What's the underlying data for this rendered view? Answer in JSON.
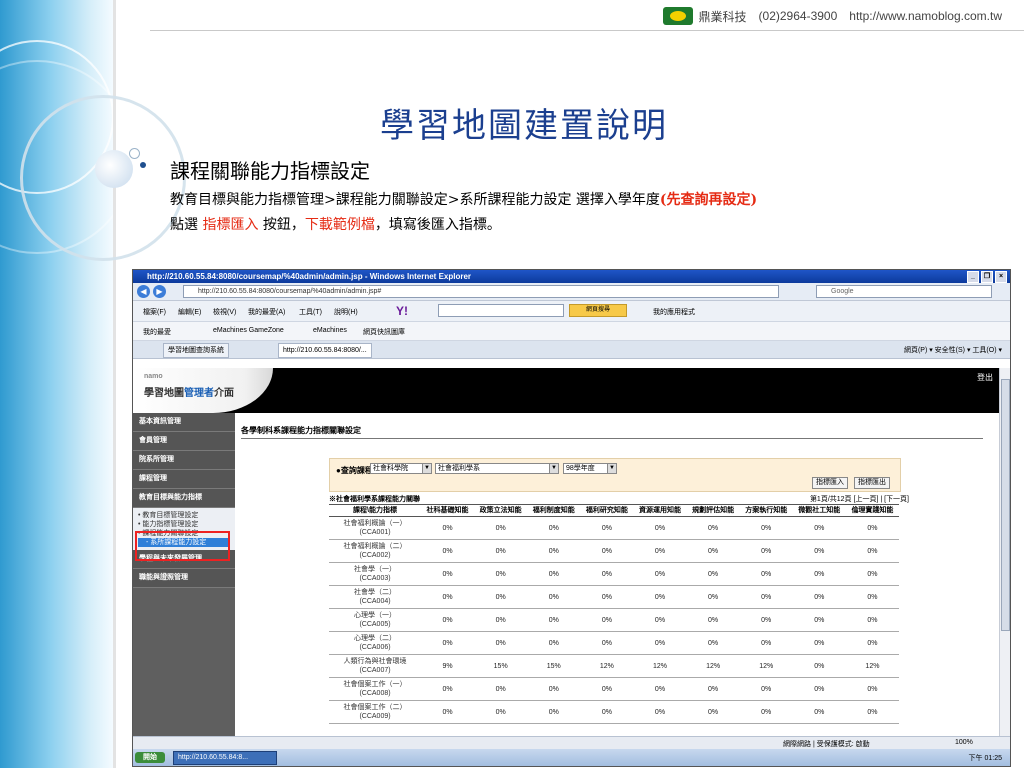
{
  "brand": {
    "name": "鼎業科技",
    "phone": "(02)2964-3900",
    "url": "http://www.namoblog.com.tw"
  },
  "slide": {
    "title": "學習地圖建置說明",
    "bullet": "課程關聯能力指標設定",
    "line2_a": "教育目標與能力指標管理>課程能力關聯設定>系所課程能力設定 選擇入學年度",
    "line2_b": "(先查詢再設定)",
    "line3_a": "點選 ",
    "line3_b": "指標匯入",
    "line3_c": " 按鈕，",
    "line3_d": "下載範例檔",
    "line3_e": "，填寫後匯入指標。"
  },
  "browser": {
    "window_title": "http://210.60.55.84:8080/coursemap/%40admin/admin.jsp - Windows Internet Explorer",
    "address": "http://210.60.55.84:8080/coursemap/%40admin/admin.jsp#",
    "search_placeholder": "Google",
    "menu": [
      "檔案(F)",
      "編輯(E)",
      "檢視(V)",
      "我的最愛(A)",
      "工具(T)",
      "說明(H)"
    ],
    "yahoo": "Y!",
    "yahoo_btn": "網頁搜尋",
    "apps_label": "我的應用程式",
    "favorites": [
      "我的最愛",
      "eMachines GameZone",
      "eMachines",
      "網頁快訊圖庫"
    ],
    "tabs": [
      "學習地圖查詢系統",
      "http://210.60.55.84:8080/..."
    ],
    "tools": "網頁(P) ▾  安全性(S) ▾  工具(O) ▾"
  },
  "app": {
    "brand_small": "namo",
    "brand_name_a": "學習地圖",
    "brand_name_b": "管理者",
    "brand_name_c": "介面",
    "logout": "登出",
    "sidebar": [
      "基本資訊管理",
      "會員管理",
      "院系所管理",
      "課程管理",
      "教育目標與能力指標"
    ],
    "sub_items": [
      "• 教育目標管理設定",
      "• 能力指標管理設定",
      "• 課程能力關聯設定"
    ],
    "sub_selected": "- 系所課程能力設定",
    "sidebar_after": [
      "學程與未來發展管理",
      "職能與證照管理"
    ]
  },
  "page": {
    "title": "各學制科系課程能力指標關聯設定",
    "query_label": "●查詢課程",
    "college": "社會科學院",
    "department": "社會福利學系",
    "year": "98學年度",
    "btn_import": "指標匯入",
    "btn_export": "指標匯出",
    "subtitle": "※社會福利學系課程能力關聯",
    "pager": "第1頁/共12頁 [上一頁] | [下一頁]",
    "columns": [
      "課程\\能力指標",
      "社科基礎知能",
      "政策立法知能",
      "福利制度知能",
      "福利研究知能",
      "資源運用知能",
      "規劃評估知能",
      "方案執行知能",
      "微觀社工知能",
      "倫理實踐知能"
    ],
    "rows": [
      {
        "name": "社會福利概論（一）",
        "code": "(CCA001)",
        "vals": [
          "0%",
          "0%",
          "0%",
          "0%",
          "0%",
          "0%",
          "0%",
          "0%",
          "0%"
        ]
      },
      {
        "name": "社會福利概論（二）",
        "code": "(CCA002)",
        "vals": [
          "0%",
          "0%",
          "0%",
          "0%",
          "0%",
          "0%",
          "0%",
          "0%",
          "0%"
        ]
      },
      {
        "name": "社會學（一）",
        "code": "(CCA003)",
        "vals": [
          "0%",
          "0%",
          "0%",
          "0%",
          "0%",
          "0%",
          "0%",
          "0%",
          "0%"
        ]
      },
      {
        "name": "社會學（二）",
        "code": "(CCA004)",
        "vals": [
          "0%",
          "0%",
          "0%",
          "0%",
          "0%",
          "0%",
          "0%",
          "0%",
          "0%"
        ]
      },
      {
        "name": "心理學（一）",
        "code": "(CCA005)",
        "vals": [
          "0%",
          "0%",
          "0%",
          "0%",
          "0%",
          "0%",
          "0%",
          "0%",
          "0%"
        ]
      },
      {
        "name": "心理學（二）",
        "code": "(CCA006)",
        "vals": [
          "0%",
          "0%",
          "0%",
          "0%",
          "0%",
          "0%",
          "0%",
          "0%",
          "0%"
        ]
      },
      {
        "name": "人類行為與社會環境",
        "code": "(CCA007)",
        "vals": [
          "9%",
          "15%",
          "15%",
          "12%",
          "12%",
          "12%",
          "12%",
          "0%",
          "12%"
        ]
      },
      {
        "name": "社會個案工作（一）",
        "code": "(CCA008)",
        "vals": [
          "0%",
          "0%",
          "0%",
          "0%",
          "0%",
          "0%",
          "0%",
          "0%",
          "0%"
        ]
      },
      {
        "name": "社會個案工作（二）",
        "code": "(CCA009)",
        "vals": [
          "0%",
          "0%",
          "0%",
          "0%",
          "0%",
          "0%",
          "0%",
          "0%",
          "0%"
        ]
      }
    ]
  },
  "status": {
    "zone": "網際網路 | 受保護模式: 啟動",
    "zoom": "100%"
  },
  "taskbar": {
    "start": "開始",
    "task": "http://210.60.55.84:8...",
    "clock": "下午 01:25"
  }
}
